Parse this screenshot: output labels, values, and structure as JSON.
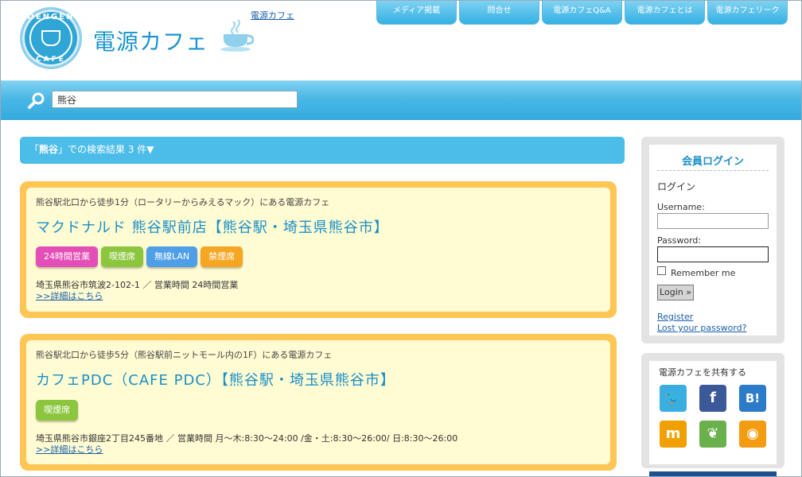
{
  "header": {
    "logo_badge_top": "DENGEN",
    "logo_badge_bottom": "CAFE",
    "logo_text": "電源カフェ",
    "top_link": "電源カフェ",
    "nav": [
      "メディア掲載",
      "問合せ",
      "電源カフェQ&A",
      "電源カフェとは",
      "電源カフェリーク"
    ]
  },
  "search": {
    "value": "熊谷"
  },
  "results": {
    "summary_prefix": "「",
    "keyword": "熊谷",
    "summary_suffix": "」での検索結果 3 件▼"
  },
  "cards": [
    {
      "sub": "熊谷駅北口から徒歩1分（ロータリーからみえるマック）にある電源カフェ",
      "title": "マクドナルド 熊谷駅前店【熊谷駅・埼玉県熊谷市】",
      "tags": [
        {
          "label": "24時間営業",
          "color": "#e34fb6"
        },
        {
          "label": "喫煙席",
          "color": "#8cc63e"
        },
        {
          "label": "無線LAN",
          "color": "#4f9ee8"
        },
        {
          "label": "禁煙席",
          "color": "#f5a623"
        }
      ],
      "address": "埼玉県熊谷市筑波2-102-1 ／ 営業時間 24時間営業",
      "detail": ">>詳細はこちら"
    },
    {
      "sub": "熊谷駅北口から徒歩5分（熊谷駅前ニットモール内の1F）にある電源カフェ",
      "title": "カフェPDC（CAFE PDC）【熊谷駅・埼玉県熊谷市】",
      "tags": [
        {
          "label": "喫煙席",
          "color": "#8cc63e"
        }
      ],
      "address": "埼玉県熊谷市銀座2丁目245番地 ／ 営業時間 月～木:8:30～24:00 /金・土:8:30～26:00/ 日:8:30～26:00",
      "detail": ">>詳細はこちら"
    }
  ],
  "login": {
    "title": "会員ログイン",
    "heading": "ログイン",
    "username_label": "Username:",
    "password_label": "Password:",
    "remember_label": "Remember me",
    "button": "Login »",
    "register": "Register",
    "lost_password": "Lost your password?"
  },
  "share": {
    "title": "電源カフェを共有する",
    "icons": [
      {
        "name": "twitter-icon",
        "glyph": "🐦",
        "color": "#3aaee0"
      },
      {
        "name": "facebook-icon",
        "glyph": "f",
        "color": "#3b5998"
      },
      {
        "name": "hatena-bookmark-icon",
        "glyph": "B!",
        "color": "#2b7bc9"
      },
      {
        "name": "mixi-icon",
        "glyph": "m",
        "color": "#f0a000"
      },
      {
        "name": "evernote-icon",
        "glyph": "❦",
        "color": "#6ab04c"
      },
      {
        "name": "rss-icon",
        "glyph": "◉",
        "color": "#f39c12"
      }
    ]
  }
}
